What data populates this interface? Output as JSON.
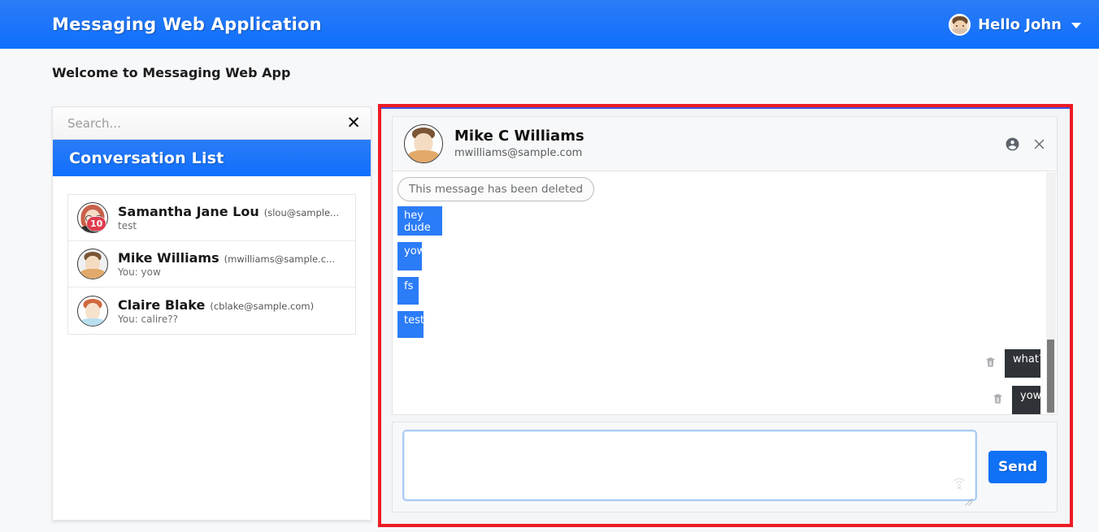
{
  "navbar": {
    "brand": "Messaging Web Application",
    "user_greeting": "Hello John",
    "avatar_icon": "user-avatar-icon",
    "caret_icon": "chevron-down-icon",
    "bg_color": "#0f6ffc"
  },
  "page": {
    "welcome": "Welcome to Messaging Web App"
  },
  "search": {
    "placeholder": "Search...",
    "value": "",
    "clear_icon": "close-x-icon"
  },
  "conversation_panel": {
    "title": "Conversation List",
    "items": [
      {
        "name": "Samantha Jane Lou",
        "email": "(slou@sample...",
        "preview": "test",
        "badge": "10",
        "avatar_icon": "woman-glasses-avatar-icon"
      },
      {
        "name": "Mike Williams",
        "email": "(mwilliams@sample.c...",
        "preview": "You: yow",
        "badge": "",
        "avatar_icon": "man-avatar-icon"
      },
      {
        "name": "Claire Blake",
        "email": "(cblake@sample.com)",
        "preview": "You: calire??",
        "badge": "",
        "avatar_icon": "man-red-hair-avatar-icon"
      }
    ]
  },
  "chat": {
    "contact_name": "Mike C Williams",
    "contact_email": "mwilliams@sample.com",
    "profile_icon": "account-circle-icon",
    "close_icon": "close-x-icon",
    "highlight_color": "#ee1b24",
    "incoming_bubble_color": "#2b7cf7",
    "outgoing_bubble_color": "#2f3337",
    "messages": [
      {
        "text": "This message has been deleted",
        "type": "deleted",
        "side": "left"
      },
      {
        "text": "hey dude",
        "type": "normal",
        "side": "left"
      },
      {
        "text": "yow",
        "type": "normal",
        "side": "left"
      },
      {
        "text": "fs",
        "type": "normal",
        "side": "left"
      },
      {
        "text": "test",
        "type": "normal",
        "side": "left"
      },
      {
        "text": "what?",
        "type": "normal",
        "side": "right",
        "delete_icon": "trash-icon"
      },
      {
        "text": "yow",
        "type": "normal",
        "side": "right",
        "delete_icon": "trash-icon"
      }
    ]
  },
  "compose": {
    "placeholder": "",
    "value": "",
    "mic_icon": "speech-off-icon",
    "resize_icon": "resize-grip-icon",
    "send_label": "Send",
    "send_color": "#1071f5"
  }
}
